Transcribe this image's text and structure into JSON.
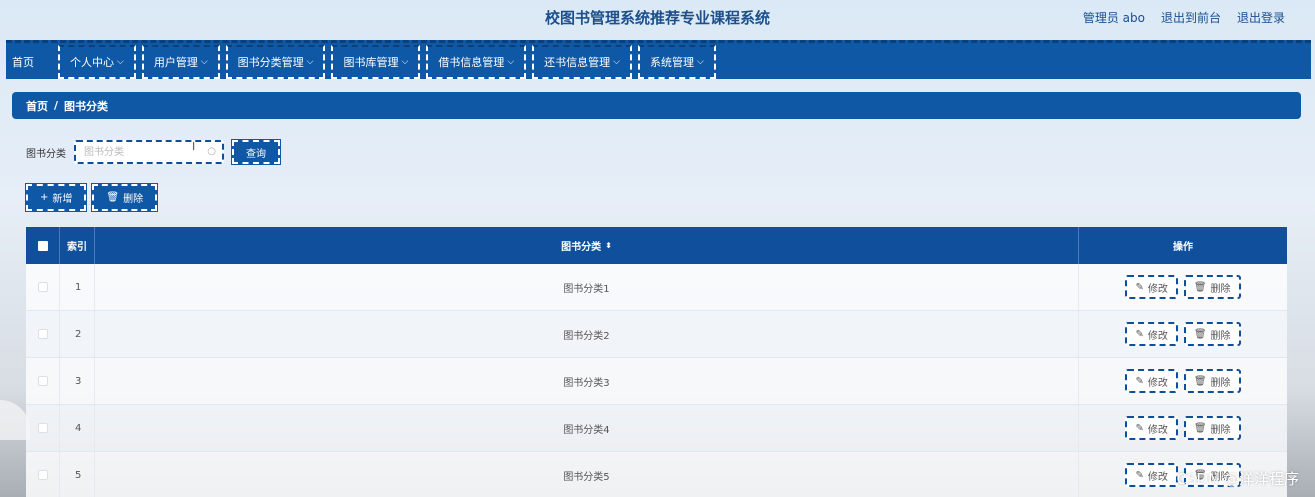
{
  "header": {
    "title": "校图书管理系统推荐专业课程系统",
    "admin": "管理员 abo",
    "to_front": "退出到前台",
    "logout": "退出登录"
  },
  "nav": {
    "items": [
      {
        "label": "首页",
        "chevron": ""
      },
      {
        "label": "个人中心",
        "chevron": "⌵"
      },
      {
        "label": "用户管理",
        "chevron": "⌵"
      },
      {
        "label": "图书分类管理",
        "chevron": "⌵"
      },
      {
        "label": "图书库管理",
        "chevron": "⌵"
      },
      {
        "label": "借书信息管理",
        "chevron": "⌵"
      },
      {
        "label": "还书信息管理",
        "chevron": "⌵"
      },
      {
        "label": "系统管理",
        "chevron": "⌵"
      }
    ]
  },
  "breadcrumb": {
    "home": "首页",
    "sep": "/",
    "current": "图书分类"
  },
  "search": {
    "label": "图书分类",
    "placeholder": "图书分类",
    "button": "查询"
  },
  "toolbar": {
    "add": "新增",
    "delete": "删除"
  },
  "table": {
    "headers": {
      "index": "索引",
      "category": "图书分类",
      "ops": "操作"
    },
    "rows": [
      {
        "index": "1",
        "category": "图书分类1"
      },
      {
        "index": "2",
        "category": "图书分类2"
      },
      {
        "index": "3",
        "category": "图书分类3"
      },
      {
        "index": "4",
        "category": "图书分类4"
      },
      {
        "index": "5",
        "category": "图书分类5"
      }
    ],
    "edit_label": "修改",
    "delete_label": "删除"
  },
  "watermark": "CSDN @洋洋程序"
}
